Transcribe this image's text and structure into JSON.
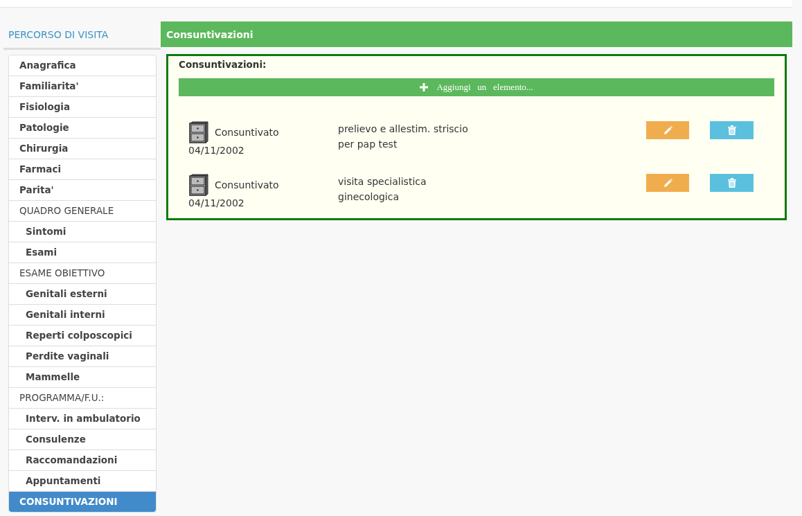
{
  "sidebar": {
    "title": "PERCORSO DI VISITA",
    "items": [
      {
        "label": "Anagrafica",
        "kind": "item",
        "selected": false
      },
      {
        "label": "Familiarita'",
        "kind": "item",
        "selected": false
      },
      {
        "label": "Fisiologia",
        "kind": "item",
        "selected": false
      },
      {
        "label": "Patologie",
        "kind": "item",
        "selected": false
      },
      {
        "label": "Chirurgia",
        "kind": "item",
        "selected": false
      },
      {
        "label": "Farmaci",
        "kind": "item",
        "selected": false
      },
      {
        "label": "Parita'",
        "kind": "item",
        "selected": false
      },
      {
        "label": "QUADRO GENERALE",
        "kind": "section",
        "selected": false
      },
      {
        "label": "Sintomi",
        "kind": "subitem",
        "selected": false
      },
      {
        "label": "Esami",
        "kind": "subitem",
        "selected": false
      },
      {
        "label": "ESAME OBIETTIVO",
        "kind": "section",
        "selected": false
      },
      {
        "label": "Genitali esterni",
        "kind": "subitem",
        "selected": false
      },
      {
        "label": "Genitali interni",
        "kind": "subitem",
        "selected": false
      },
      {
        "label": "Reperti colposcopici",
        "kind": "subitem",
        "selected": false
      },
      {
        "label": "Perdite vaginali",
        "kind": "subitem",
        "selected": false
      },
      {
        "label": "Mammelle",
        "kind": "subitem",
        "selected": false
      },
      {
        "label": "PROGRAMMA/F.U.:",
        "kind": "section",
        "selected": false
      },
      {
        "label": "Interv. in ambulatorio",
        "kind": "subitem",
        "selected": false
      },
      {
        "label": "Consulenze",
        "kind": "subitem",
        "selected": false
      },
      {
        "label": "Raccomandazioni",
        "kind": "subitem",
        "selected": false
      },
      {
        "label": "Appuntamenti",
        "kind": "subitem",
        "selected": false
      },
      {
        "label": "CONSUNTIVAZIONI",
        "kind": "section",
        "selected": true
      }
    ]
  },
  "panel": {
    "title": "Consuntivazioni",
    "box_title": "Consuntivazioni:",
    "add_button": "Aggiungi   un   elemento...",
    "entries": [
      {
        "status": "Consuntivato",
        "date": "04/11/2002",
        "description_lines": [
          "prelievo e allestim. striscio",
          "per pap test"
        ]
      },
      {
        "status": "Consuntivato",
        "date": "04/11/2002",
        "description_lines": [
          "visita specialistica",
          "ginecologica"
        ]
      }
    ]
  }
}
